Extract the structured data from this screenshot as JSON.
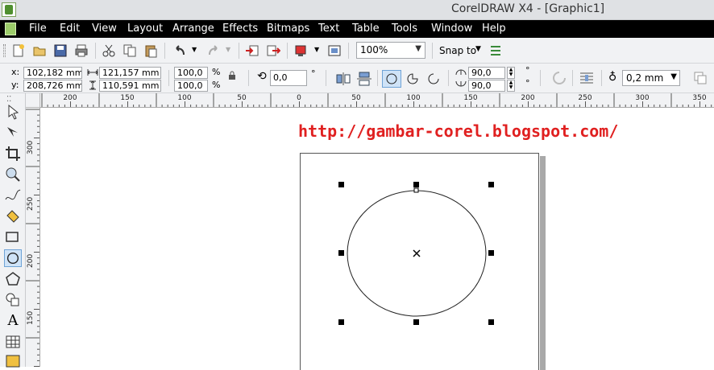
{
  "window": {
    "title": "CorelDRAW X4 - [Graphic1]"
  },
  "menu": [
    "File",
    "Edit",
    "View",
    "Layout",
    "Arrange",
    "Effects",
    "Bitmaps",
    "Text",
    "Table",
    "Tools",
    "Window",
    "Help"
  ],
  "toolbar": {
    "zoom_value": "100%",
    "snap_label": "Snap to",
    "icons": [
      "new-icon",
      "open-icon",
      "save-icon",
      "print-icon",
      "cut-icon",
      "copy-icon",
      "paste-icon",
      "undo-icon",
      "redo-icon",
      "import-icon",
      "export-icon",
      "application-launcher-icon",
      "welcome-screen-icon",
      "options-icon"
    ]
  },
  "property_bar": {
    "x_label": "x:",
    "y_label": "y:",
    "x_value": "102,182 mm",
    "y_value": "208,726 mm",
    "width_value": "121,157 mm",
    "height_value": "110,591 mm",
    "scale_x": "100,0",
    "scale_y": "100,0",
    "percent": "%",
    "rotation": "0,0",
    "degree": "°",
    "start_angle": "90,0",
    "end_angle": "90,0",
    "outline_width": "0,2 mm"
  },
  "rulers": {
    "horizontal_labels": [
      "200",
      "150",
      "100",
      "50",
      "0",
      "50",
      "100",
      "150",
      "200",
      "250",
      "300",
      "350"
    ],
    "vertical_labels": [
      "300",
      "250",
      "200",
      "150"
    ]
  },
  "canvas": {
    "watermark": "http://gambar-corel.blogspot.com/",
    "shape": "ellipse"
  },
  "colors": {
    "menubar_bg": "#000000",
    "watermark": "#e02020",
    "selection_handle": "#000000",
    "active_tool": "#cfe3f7"
  }
}
